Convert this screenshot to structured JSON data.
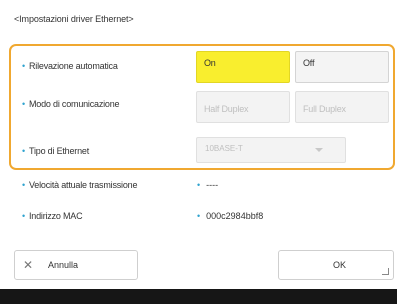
{
  "dialog": {
    "title": "<Impostazioni driver Ethernet>"
  },
  "rows": {
    "auto_detect": {
      "label": "Rilevazione automatica",
      "on_label": "On",
      "off_label": "Off"
    },
    "comm_mode": {
      "label": "Modo di comunicazione",
      "half_label": "Half Duplex",
      "full_label": "Full Duplex"
    },
    "ethernet_type": {
      "label": "Tipo di Ethernet",
      "value": "10BASE-T"
    }
  },
  "info": {
    "speed": {
      "label": "Velocità attuale trasmissione",
      "value": "----"
    },
    "mac": {
      "label": "Indirizzo MAC",
      "value": "000c2984bbf8"
    }
  },
  "buttons": {
    "cancel_label": "Annulla",
    "ok_label": "OK"
  },
  "colors": {
    "accent_frame": "#f0a830",
    "selected_button": "#f9ee2e",
    "bullet": "#2fa3cf"
  }
}
